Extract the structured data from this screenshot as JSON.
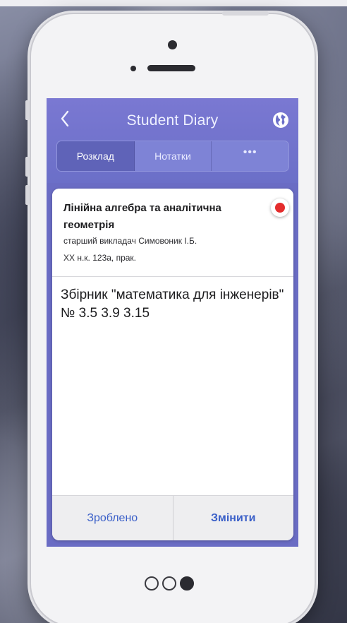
{
  "app": {
    "title": "Student Diary"
  },
  "tabs": [
    {
      "label": "Розклад",
      "active": true
    },
    {
      "label": "Нотатки",
      "active": false
    },
    {
      "label": "•••",
      "active": false
    }
  ],
  "lesson": {
    "subject": "Лінійна алгебра та аналітична геометрія",
    "teacher": "старший викладач Симовоник І.Б.",
    "room": "XX н.к. 123а, прак.",
    "status_color": "#e42c2c"
  },
  "note": {
    "text": "Збірник \"математика для інженерів\" № 3.5 3.9 3.15"
  },
  "actions": {
    "done_label": "Зроблено",
    "edit_label": "Змінити"
  },
  "pager": {
    "total": 3,
    "current": 3
  },
  "colors": {
    "nav": "#6b6fc8",
    "accent": "#3a5fc8",
    "status": "#e42c2c"
  }
}
